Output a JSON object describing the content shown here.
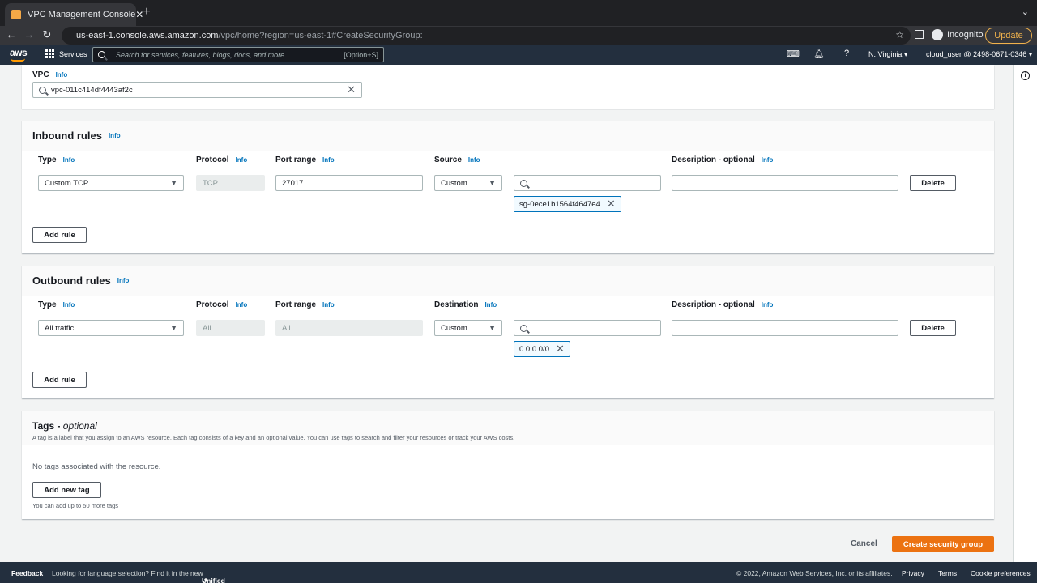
{
  "browser": {
    "tab_title": "VPC Management Console",
    "url_host": "us-east-1.console.aws.amazon.com",
    "url_path": "/vpc/home?region=us-east-1#CreateSecurityGroup:",
    "incognito": "Incognito",
    "update": "Update"
  },
  "awsnav": {
    "logo": "aws",
    "services": "Services",
    "search_placeholder": "Search for services, features, blogs, docs, and more",
    "search_shortcut": "[Option+S]",
    "region": "N. Virginia ▾",
    "account": "cloud_user @ 2498-0671-0346 ▾"
  },
  "vpc": {
    "label": "VPC",
    "info": "Info",
    "value": "vpc-011c414df4443af2c"
  },
  "inbound": {
    "title": "Inbound rules",
    "info": "Info",
    "headers": {
      "type": "Type",
      "protocol": "Protocol",
      "port_range": "Port range",
      "source": "Source",
      "description": "Description - optional"
    },
    "rule": {
      "type": "Custom TCP",
      "protocol": "TCP",
      "port_range": "27017",
      "source": "Custom",
      "token": "sg-0ece1b1564f4647e4"
    },
    "delete": "Delete",
    "add_rule": "Add rule"
  },
  "outbound": {
    "title": "Outbound rules",
    "info": "Info",
    "headers": {
      "type": "Type",
      "protocol": "Protocol",
      "port_range": "Port range",
      "destination": "Destination",
      "description": "Description - optional"
    },
    "rule": {
      "type": "All traffic",
      "protocol": "All",
      "port_range": "All",
      "destination": "Custom",
      "token": "0.0.0.0/0"
    },
    "delete": "Delete",
    "add_rule": "Add rule"
  },
  "tags": {
    "title": "Tags - ",
    "title_optional": "optional",
    "description": "A tag is a label that you assign to an AWS resource. Each tag consists of a key and an optional value. You can use tags to search and filter your resources or track your AWS costs.",
    "empty": "No tags associated with the resource.",
    "add_tag": "Add new tag",
    "limit": "You can add up to 50 more tags"
  },
  "actions": {
    "cancel": "Cancel",
    "create": "Create security group"
  },
  "footer": {
    "feedback": "Feedback",
    "lang_prompt": "Looking for language selection? Find it in the new",
    "unified_settings": "Unified Settings",
    "copyright": "© 2022, Amazon Web Services, Inc. or its affiliates.",
    "privacy": "Privacy",
    "terms": "Terms",
    "cookies": "Cookie preferences"
  },
  "colors": {
    "primary_button": "#ec7211",
    "link": "#0073bb",
    "aws_nav": "#232f3e"
  }
}
